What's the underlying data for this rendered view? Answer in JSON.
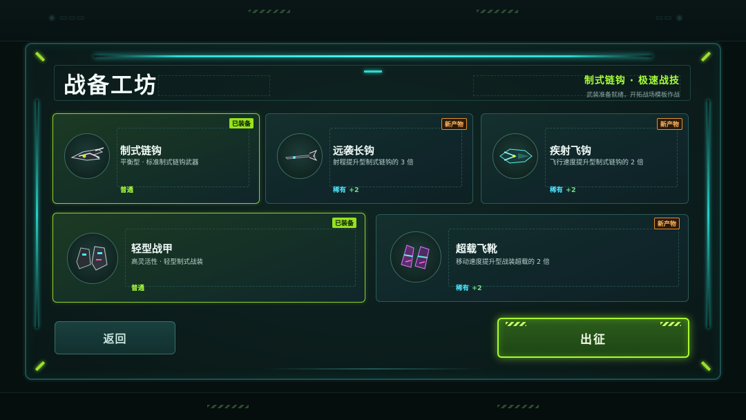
{
  "screen": {
    "title": "战备工坊",
    "header": {
      "loadout_title": "制式链钩 · 极速战技",
      "loadout_subtitle": "武装准备就绪，开拓战场模板作战"
    }
  },
  "items": [
    {
      "name": "制式链钩",
      "desc": "平衡型 · 标准制式链钩武器",
      "rarity": "普通",
      "rarity_bonus": "",
      "badge": "已装备",
      "equipped": true,
      "icon": "grapple-hook-icon"
    },
    {
      "name": "远袭长钩",
      "desc": "射程提升型制式链钩的 3 倍",
      "rarity": "稀有",
      "rarity_bonus": "+2",
      "badge": "新产物",
      "equipped": false,
      "icon": "long-hook-icon"
    },
    {
      "name": "疾射飞钩",
      "desc": "飞行速度提升型制式链钩的 2 倍",
      "rarity": "稀有",
      "rarity_bonus": "+2",
      "badge": "新产物",
      "equipped": false,
      "icon": "fast-hook-icon"
    },
    {
      "name": "轻型战甲",
      "desc": "高灵活性 · 轻型制式战装",
      "rarity": "普通",
      "rarity_bonus": "",
      "badge": "已装备",
      "equipped": true,
      "icon": "light-armor-boots-icon"
    },
    {
      "name": "超载飞靴",
      "desc": "移动速度提升型战装超载的 2 倍",
      "rarity": "稀有",
      "rarity_bonus": "+2",
      "badge": "新产物",
      "equipped": false,
      "icon": "overdrive-boots-icon"
    }
  ],
  "buttons": {
    "back": "返回",
    "deploy": "出征"
  },
  "colors": {
    "accent_green": "#a6ff2f",
    "accent_cyan": "#2fd9d0",
    "new_badge_orange": "#e6922b",
    "rare_cyan": "#4fe6ff"
  }
}
